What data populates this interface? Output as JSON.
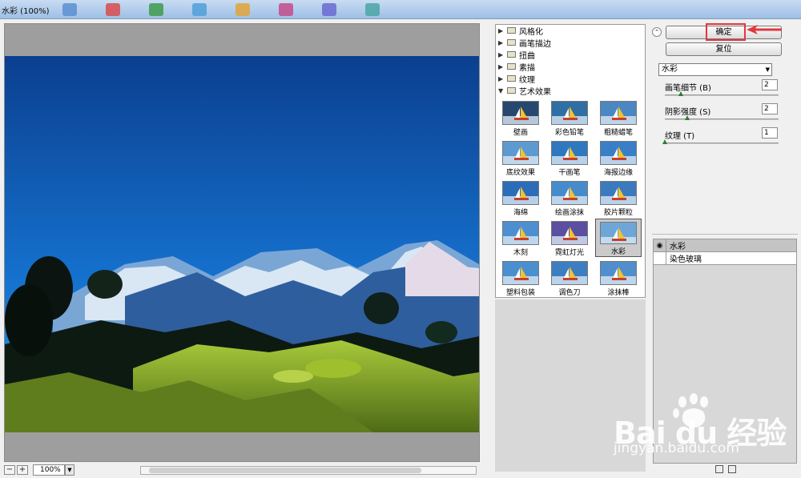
{
  "window": {
    "title": "水彩 (100%)"
  },
  "taskbar_icons": [
    "app-icon-1",
    "app-icon-2",
    "app-icon-3",
    "app-icon-4",
    "app-icon-5",
    "app-icon-6",
    "app-icon-7",
    "app-icon-8"
  ],
  "preview": {
    "zoom": "100%",
    "zoom_out": "−",
    "zoom_in": "+"
  },
  "categories": [
    {
      "label": "风格化",
      "expanded": false
    },
    {
      "label": "画笔描边",
      "expanded": false
    },
    {
      "label": "扭曲",
      "expanded": false
    },
    {
      "label": "素描",
      "expanded": false
    },
    {
      "label": "纹理",
      "expanded": false
    },
    {
      "label": "艺术效果",
      "expanded": true
    }
  ],
  "filters": [
    {
      "label": "壁画"
    },
    {
      "label": "彩色铅笔"
    },
    {
      "label": "粗糙蜡笔"
    },
    {
      "label": "底纹效果"
    },
    {
      "label": "干画笔"
    },
    {
      "label": "海报边缘"
    },
    {
      "label": "海绵"
    },
    {
      "label": "绘画涂抹"
    },
    {
      "label": "胶片颗粒"
    },
    {
      "label": "木刻"
    },
    {
      "label": "霓虹灯光"
    },
    {
      "label": "水彩"
    },
    {
      "label": "塑料包装"
    },
    {
      "label": "调色刀"
    },
    {
      "label": "涂抹棒"
    }
  ],
  "selected_filter": "水彩",
  "settings": {
    "ok_label": "确定",
    "reset_label": "复位",
    "filter_select": "水彩",
    "params": [
      {
        "label": "画笔细节 (B)",
        "value": "2",
        "level": 0.14
      },
      {
        "label": "阴影强度 (S)",
        "value": "2",
        "level": 0.2
      },
      {
        "label": "纹理 (T)",
        "value": "1",
        "level": 0.0
      }
    ]
  },
  "layers": [
    {
      "label": "水彩",
      "visible": true,
      "active": true
    },
    {
      "label": "染色玻璃",
      "visible": false,
      "active": false
    }
  ],
  "watermark": {
    "brand": "Bai du 经验",
    "url": "jingyan.baidu.com"
  },
  "colors": {
    "highlight": "#e2383d",
    "sky_top": "#0b3f8f",
    "sky_bottom": "#1a8be0"
  }
}
